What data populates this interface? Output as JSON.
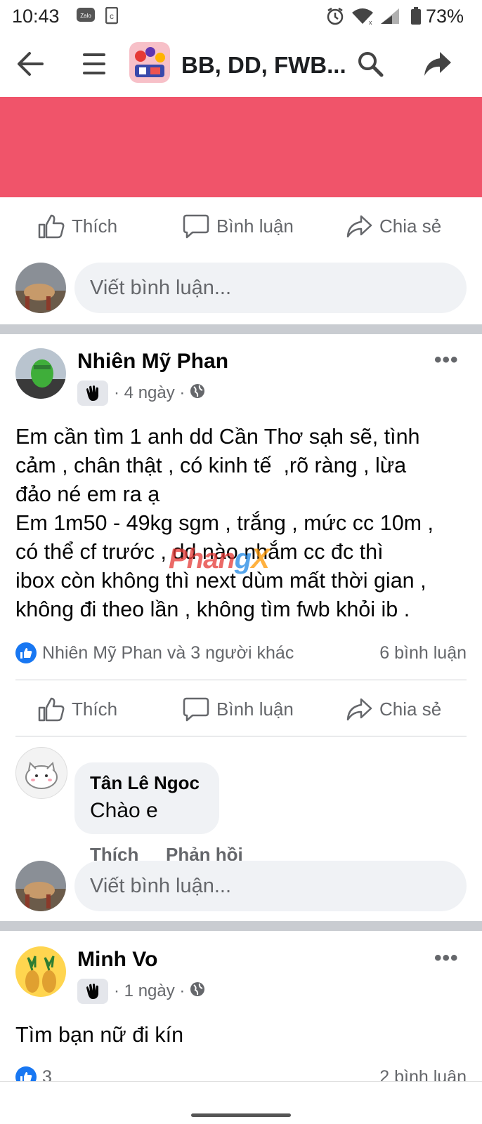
{
  "status_bar": {
    "time": "10:43",
    "battery": "73%",
    "zalo_label": "Zalo"
  },
  "app_bar": {
    "title": "BB, DD, FWB..."
  },
  "icons": {
    "back": "arrow-left-icon",
    "menu": "hamburger-icon",
    "group": "group-avatar-icon",
    "search": "search-icon",
    "share": "share-arrow-icon"
  },
  "colors": {
    "banner": "#f0546a",
    "accent": "#1877f2"
  },
  "actions": {
    "like": "Thích",
    "comment": "Bình luận",
    "share": "Chia sẻ"
  },
  "comment_input": {
    "placeholder": "Viết bình luận..."
  },
  "post1": {
    "author": "Nhiên Mỹ Phan",
    "time": "4 ngày",
    "text": "Em cần tìm 1 anh dd Cần Thơ sạh sẽ, tình\ncảm , chân thật , có kinh tế  ,rõ ràng , lừa\nđảo né em ra ạ\nEm 1m50 - 49kg sgm , trắng , mức cc 10m ,\ncó thể cf trước , dd nào nhắm cc đc thì\nibox còn không thì next dùm mất thời gian ,\nkhông đi theo lần , không tìm fwb khỏi ib .",
    "reactions": "Nhiên Mỹ Phan và 3 người khác",
    "comments": "6 bình luận",
    "watermark": [
      "Phan",
      "g",
      "X"
    ]
  },
  "comment1": {
    "author": "Tân Lê Ngoc",
    "text": "Chào  e",
    "like": "Thích",
    "reply": "Phản hồi"
  },
  "post2": {
    "author": "Minh Vo",
    "time": "1 ngày",
    "text": "Tìm bạn nữ đi kín",
    "reactions": "3",
    "comments": "2 bình luận"
  }
}
